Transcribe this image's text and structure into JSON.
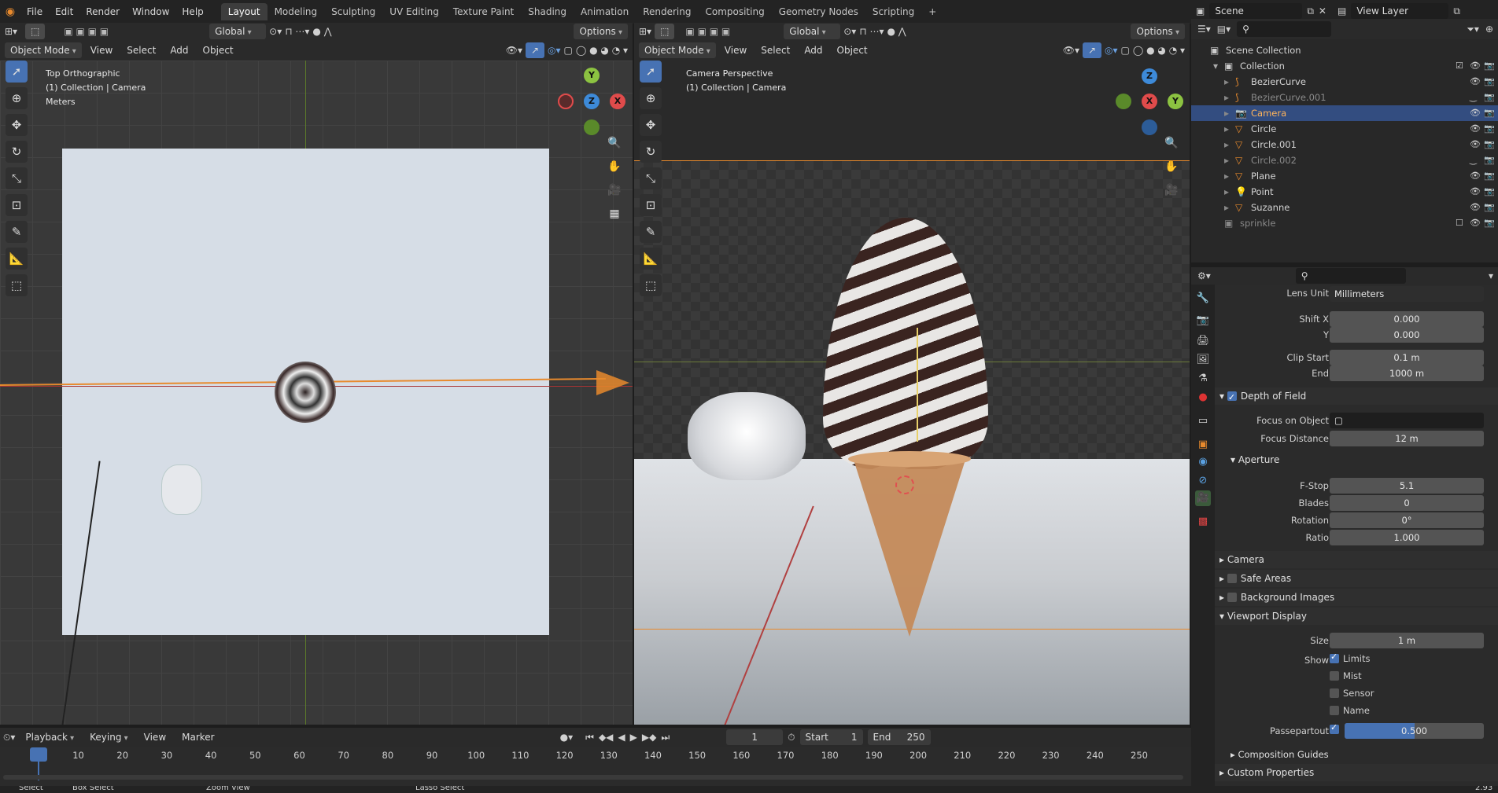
{
  "topbar": {
    "menus": [
      "File",
      "Edit",
      "Render",
      "Window",
      "Help"
    ],
    "workspaces": [
      "Layout",
      "Modeling",
      "Sculpting",
      "UV Editing",
      "Texture Paint",
      "Shading",
      "Animation",
      "Rendering",
      "Compositing",
      "Geometry Nodes",
      "Scripting"
    ],
    "active_workspace": "Layout",
    "scene": "Scene",
    "view_layer": "View Layer"
  },
  "left_viewport": {
    "header": {
      "transform": "Global",
      "options": "Options",
      "mode": "Object Mode",
      "view": "View",
      "select": "Select",
      "add": "Add",
      "object": "Object"
    },
    "overlay_title": "Top Orthographic",
    "overlay_collection": "(1) Collection | Camera",
    "overlay_units": "Meters"
  },
  "right_viewport": {
    "header": {
      "transform": "Global",
      "options": "Options",
      "mode": "Object Mode",
      "view": "View",
      "select": "Select",
      "add": "Add",
      "object": "Object"
    },
    "overlay_title": "Camera Perspective",
    "overlay_collection": "(1) Collection | Camera"
  },
  "outliner": {
    "root": "Scene Collection",
    "collection": "Collection",
    "items": [
      {
        "name": "BezierCurve",
        "type": "curve",
        "dim": false,
        "sel": false
      },
      {
        "name": "BezierCurve.001",
        "type": "curve",
        "dim": true,
        "sel": false
      },
      {
        "name": "Camera",
        "type": "camera",
        "dim": false,
        "sel": true
      },
      {
        "name": "Circle",
        "type": "mesh",
        "dim": false,
        "sel": false
      },
      {
        "name": "Circle.001",
        "type": "mesh",
        "dim": false,
        "sel": false
      },
      {
        "name": "Circle.002",
        "type": "mesh",
        "dim": true,
        "sel": false
      },
      {
        "name": "Plane",
        "type": "mesh",
        "dim": false,
        "sel": false
      },
      {
        "name": "Point",
        "type": "light",
        "dim": false,
        "sel": false
      },
      {
        "name": "Suzanne",
        "type": "mesh",
        "dim": false,
        "sel": false
      }
    ],
    "sprinkle": "sprinkle"
  },
  "properties": {
    "lens_unit_label": "Lens Unit",
    "lens_unit": "Millimeters",
    "shift_x_label": "Shift X",
    "shift_x": "0.000",
    "shift_y_label": "Y",
    "shift_y": "0.000",
    "clip_start_label": "Clip Start",
    "clip_start": "0.1 m",
    "clip_end_label": "End",
    "clip_end": "1000 m",
    "dof": "Depth of Field",
    "focus_object_label": "Focus on Object",
    "focus_distance_label": "Focus Distance",
    "focus_distance": "12 m",
    "aperture": "Aperture",
    "fstop_label": "F-Stop",
    "fstop": "5.1",
    "blades_label": "Blades",
    "blades": "0",
    "rotation_label": "Rotation",
    "rotation": "0°",
    "ratio_label": "Ratio",
    "ratio": "1.000",
    "camera": "Camera",
    "safe_areas": "Safe Areas",
    "background_images": "Background Images",
    "viewport_display": "Viewport Display",
    "size_label": "Size",
    "size": "1 m",
    "show_label": "Show",
    "limits": "Limits",
    "mist": "Mist",
    "sensor": "Sensor",
    "name": "Name",
    "passepartout_label": "Passepartout",
    "passepartout": "0.500",
    "passepartout_fraction": 0.5,
    "composition_guides": "Composition Guides",
    "custom_properties": "Custom Properties"
  },
  "timeline": {
    "playback": "Playback",
    "keying": "Keying",
    "view": "View",
    "marker": "Marker",
    "current_frame": "1",
    "start_label": "Start",
    "start": "1",
    "end_label": "End",
    "end": "250",
    "ticks": [
      "1",
      "10",
      "20",
      "30",
      "40",
      "50",
      "60",
      "70",
      "80",
      "90",
      "100",
      "110",
      "120",
      "130",
      "140",
      "150",
      "160",
      "170",
      "180",
      "190",
      "200",
      "210",
      "220",
      "230",
      "240",
      "250"
    ]
  },
  "status": {
    "select": "Select",
    "box_select": "Box Select",
    "zoom_view": "Zoom View",
    "lasso_select": "Lasso Select",
    "version": "2.93"
  }
}
